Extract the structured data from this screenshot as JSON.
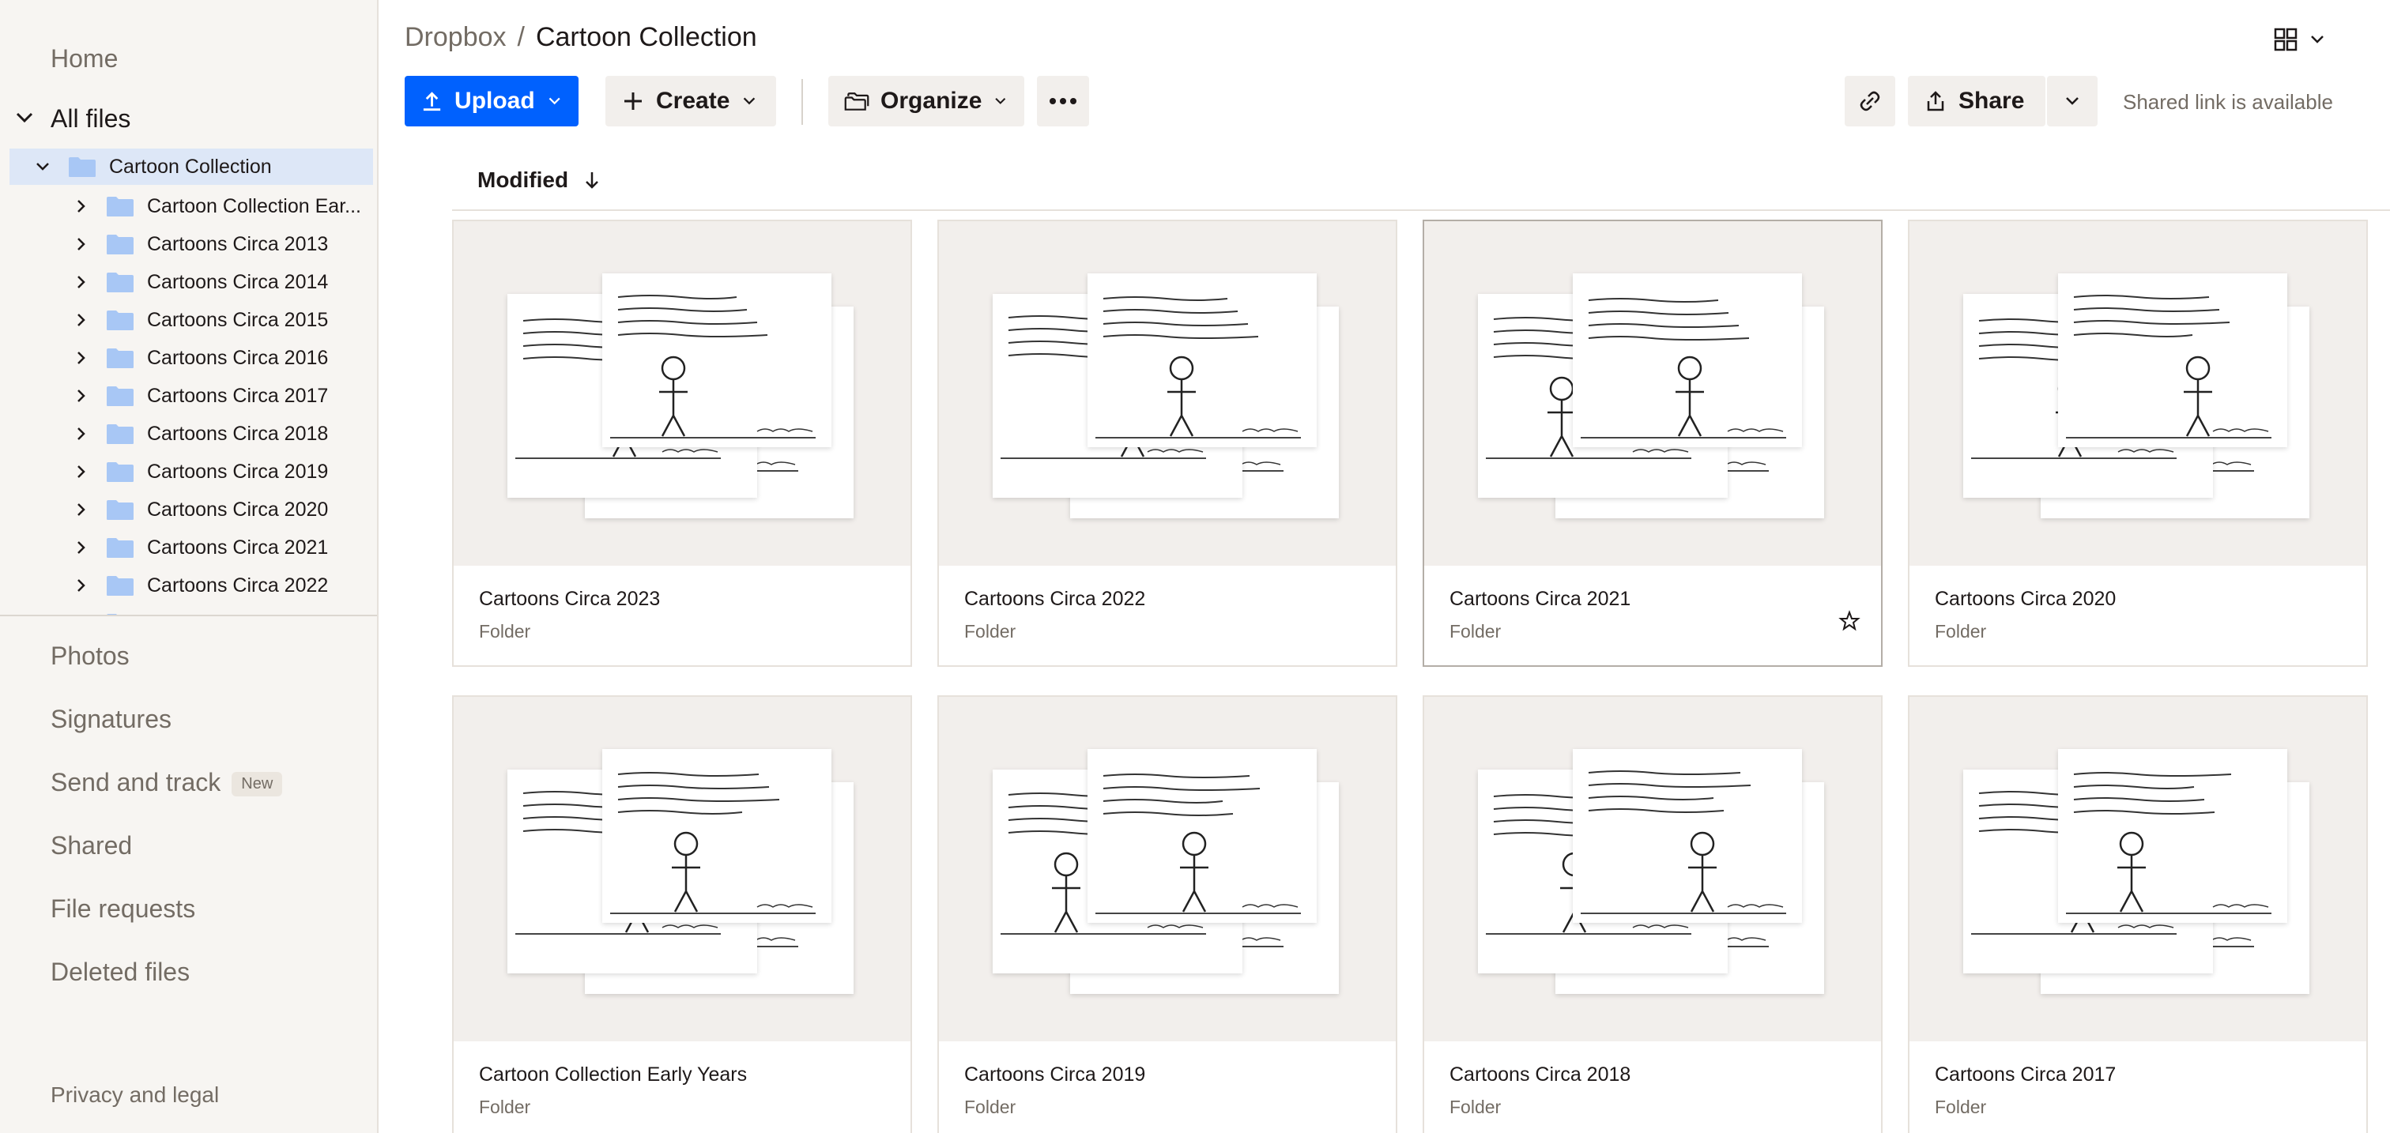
{
  "sidebar": {
    "home": "Home",
    "all_files": "All files",
    "tree": {
      "root": "Cartoon Collection",
      "children": [
        "Cartoon Collection Ear...",
        "Cartoons Circa 2013",
        "Cartoons Circa 2014",
        "Cartoons Circa 2015",
        "Cartoons Circa 2016",
        "Cartoons Circa 2017",
        "Cartoons Circa 2018",
        "Cartoons Circa 2019",
        "Cartoons Circa 2020",
        "Cartoons Circa 2021",
        "Cartoons Circa 2022"
      ]
    },
    "links": [
      "Photos",
      "Signatures",
      "Send and track",
      "Shared",
      "File requests",
      "Deleted files"
    ],
    "new_badge": "New",
    "privacy": "Privacy and legal"
  },
  "header": {
    "breadcrumb_root": "Dropbox",
    "breadcrumb_sep": "/",
    "breadcrumb_current": "Cartoon Collection"
  },
  "toolbar": {
    "upload": "Upload",
    "create": "Create",
    "organize": "Organize",
    "share": "Share",
    "shared_note": "Shared link is available"
  },
  "sort": {
    "label": "Modified"
  },
  "cards": [
    {
      "name": "Cartoons Circa 2023",
      "type": "Folder"
    },
    {
      "name": "Cartoons Circa 2022",
      "type": "Folder"
    },
    {
      "name": "Cartoons Circa 2021",
      "type": "Folder"
    },
    {
      "name": "Cartoons Circa 2020",
      "type": "Folder"
    },
    {
      "name": "Cartoon Collection Early Years",
      "type": "Folder"
    },
    {
      "name": "Cartoons Circa 2019",
      "type": "Folder"
    },
    {
      "name": "Cartoons Circa 2018",
      "type": "Folder"
    },
    {
      "name": "Cartoons Circa 2017",
      "type": "Folder"
    }
  ],
  "colors": {
    "accent": "#0061fe",
    "folder": "#a8c7f5",
    "selected_row": "#dde7f7",
    "sidebar_bg": "#f7f5f2"
  }
}
